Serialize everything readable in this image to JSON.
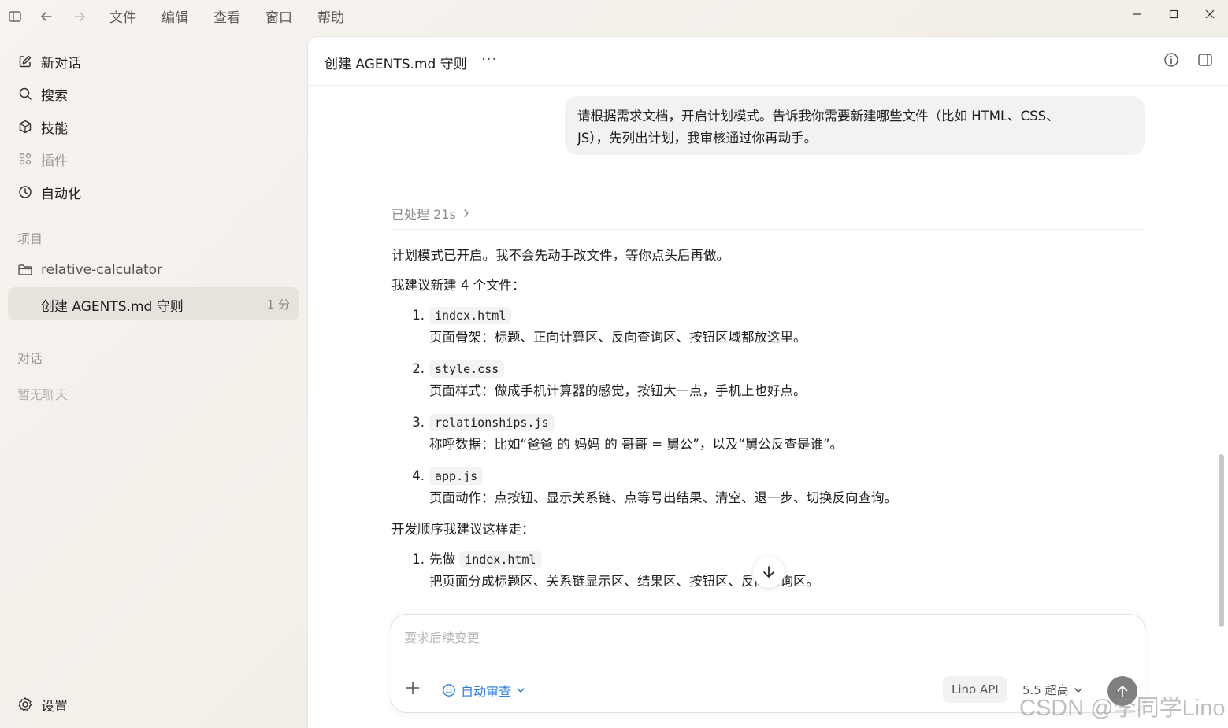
{
  "menu": [
    "文件",
    "编辑",
    "查看",
    "窗口",
    "帮助"
  ],
  "sidebar": {
    "items": [
      {
        "label": "新对话",
        "icon": "edit-icon"
      },
      {
        "label": "搜索",
        "icon": "search-icon"
      },
      {
        "label": "技能",
        "icon": "skills-icon"
      },
      {
        "label": "插件",
        "icon": "plugins-icon"
      },
      {
        "label": "自动化",
        "icon": "clock-icon"
      }
    ],
    "projects_label": "项目",
    "project_name": "relative-calculator",
    "thread_title": "创建 AGENTS.md 守则",
    "thread_time": "1 分",
    "chats_label": "对话",
    "no_chats": "暂无聊天",
    "settings_label": "设置"
  },
  "main": {
    "title": "创建 AGENTS.md 守则",
    "more": "···",
    "user_message_line1": "请根据需求文档，开启计划模式。告诉我你需要新建哪些文件（比如 HTML、CSS、",
    "user_message_line2": "JS），先列出计划，我审核通过你再动手。",
    "processed": "已处理 21s",
    "intro": "计划模式已开启。我不会先动手改文件，等你点头后再做。",
    "files_heading": "我建议新建 4 个文件：",
    "files": [
      {
        "num": "1.",
        "name": "index.html",
        "desc": "页面骨架：标题、正向计算区、反向查询区、按钮区域都放这里。"
      },
      {
        "num": "2.",
        "name": "style.css",
        "desc": "页面样式：做成手机计算器的感觉，按钮大一点，手机上也好点。"
      },
      {
        "num": "3.",
        "name": "relationships.js",
        "desc": "称呼数据：比如“爸爸 的 妈妈 的 哥哥 = 舅公”，以及“舅公反查是谁”。"
      },
      {
        "num": "4.",
        "name": "app.js",
        "desc": "页面动作：点按钮、显示关系链、点等号出结果、清空、退一步、切换反向查询。"
      }
    ],
    "order_heading": "开发顺序我建议这样走：",
    "steps": [
      {
        "num": "1.",
        "prefix": "先做",
        "name": "index.html",
        "desc": "把页面分成标题区、关系链显示区、结果区、按钮区、反向查询区。"
      }
    ]
  },
  "composer": {
    "placeholder": "要求后续变更",
    "mode": "自动审查",
    "api": "Lino API",
    "model": "5.5 超高"
  },
  "watermark": "CSDN @李同学Lino"
}
